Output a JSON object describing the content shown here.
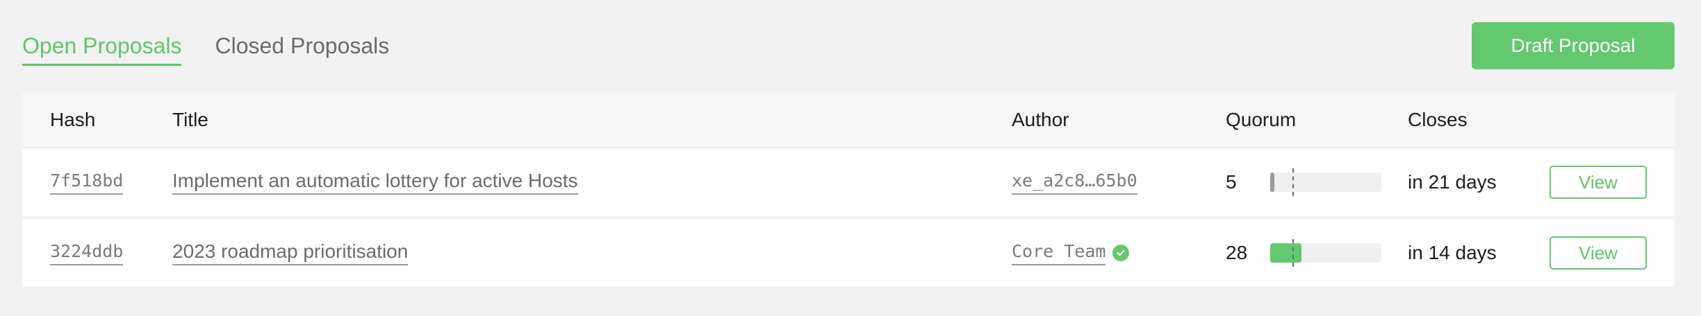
{
  "tabs": [
    {
      "label": "Open Proposals",
      "active": true
    },
    {
      "label": "Closed Proposals",
      "active": false
    }
  ],
  "draft_button": {
    "label": "Draft Proposal"
  },
  "table": {
    "columns": [
      "Hash",
      "Title",
      "Author",
      "Quorum",
      "Closes"
    ],
    "rows": [
      {
        "hash": "7f518bd",
        "title": "Implement an automatic lottery for active Hosts",
        "author": "xe_a2c8…65b0",
        "author_verified": false,
        "quorum": "5",
        "quorum_progress": 0.04,
        "quorum_threshold": 0.2,
        "quorum_bar_color": "#9a9a9a",
        "closes": "in 21 days",
        "action": "View"
      },
      {
        "hash": "3224ddb",
        "title": "2023 roadmap prioritisation",
        "author": "Core Team",
        "author_verified": true,
        "quorum": "28",
        "quorum_progress": 0.28,
        "quorum_threshold": 0.2,
        "quorum_bar_color": "#63c86e",
        "closes": "in 14 days",
        "action": "View"
      }
    ]
  },
  "colors": {
    "accent": "#5ec769",
    "muted": "#6b6b6b"
  }
}
